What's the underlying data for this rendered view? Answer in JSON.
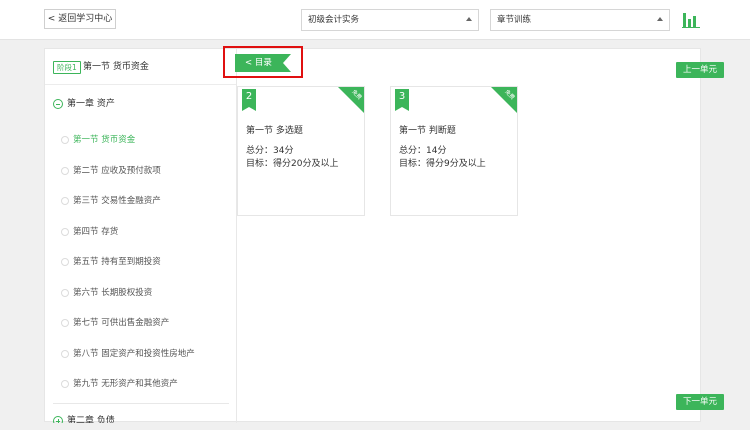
{
  "header": {
    "back_label": "< 返回学习中心",
    "subject_select": "初级会计实务",
    "mode_select": "章节训练",
    "colors": {
      "accent": "#3cb55a",
      "highlight": "#e01010"
    }
  },
  "sidebar": {
    "stage_badge": "阶段1",
    "current_section": "第一节 货币资金",
    "chapter1": "第一章 资产",
    "sections": [
      {
        "label": "第一节 货币资金"
      },
      {
        "label": "第二节 应收及预付款项"
      },
      {
        "label": "第三节 交易性金融资产"
      },
      {
        "label": "第四节 存货"
      },
      {
        "label": "第五节 持有至到期投资"
      },
      {
        "label": "第六节 长期股权投资"
      },
      {
        "label": "第七节 可供出售金融资产"
      },
      {
        "label": "第八节 固定资产和投资性房地产"
      },
      {
        "label": "第九节 无形资产和其他资产"
      }
    ],
    "chapter2": "第二章 负债"
  },
  "toc_button": "< 目录",
  "cards": [
    {
      "number": "2",
      "badge": "免费",
      "title": "第一节 多选题",
      "score": "总分：34分",
      "target": "目标：得分20分及以上"
    },
    {
      "number": "3",
      "badge": "免费",
      "title": "第一节 判断题",
      "score": "总分：14分",
      "target": "目标：得分9分及以上"
    }
  ],
  "prev_unit": "上一单元",
  "next_unit": "下一单元"
}
